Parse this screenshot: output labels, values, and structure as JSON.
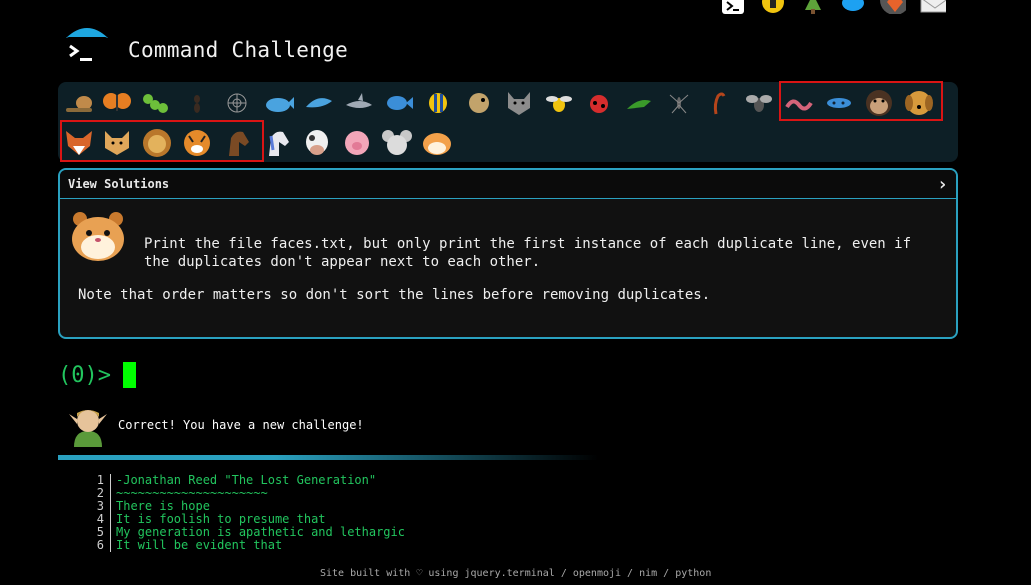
{
  "header": {
    "title": "Command Challenge",
    "top_icons": [
      "terminal-icon",
      "lightbulb-icon",
      "pine-tree-icon",
      "twitter-bird-icon",
      "badge-icon",
      "mail-icon"
    ]
  },
  "emoji_bar": {
    "row1": [
      "snail",
      "butterfly",
      "caterpillar",
      "ant",
      "spider-web",
      "whale",
      "dolphin",
      "shark",
      "fish",
      "tropical-fish",
      "pufferfish",
      "wolf",
      "bee",
      "ladybug",
      "cricket",
      "mosquito",
      "scorpion",
      "fly",
      "worm",
      "microbe",
      "monkey",
      "dog"
    ],
    "row2": [
      "fox",
      "cat",
      "lion",
      "tiger",
      "horse",
      "unicorn",
      "cow",
      "pig",
      "mouse",
      "hamster"
    ],
    "accent": "#d91414"
  },
  "panel": {
    "heading": "View Solutions",
    "chevron": "›",
    "instruction": "Print the file faces.txt, but only print the first instance of each duplicate line, even if the duplicates don't appear next to each other.",
    "note": "Note that order matters so don't sort the lines before removing duplicates."
  },
  "terminal": {
    "prompt": "(0)>",
    "message": "Correct! You have a new challenge!"
  },
  "code": {
    "lines": [
      {
        "n": "1",
        "t": "-Jonathan Reed \"The Lost Generation\""
      },
      {
        "n": "2",
        "t": "~~~~~~~~~~~~~~~~~~~~~"
      },
      {
        "n": "3",
        "t": "There is hope"
      },
      {
        "n": "4",
        "t": "It is foolish to presume that"
      },
      {
        "n": "5",
        "t": "My generation is apathetic and lethargic"
      },
      {
        "n": "6",
        "t": "It will be evident that"
      }
    ]
  },
  "footer": "Site built with ♡ using jquery.terminal / openmoji / nim / python"
}
